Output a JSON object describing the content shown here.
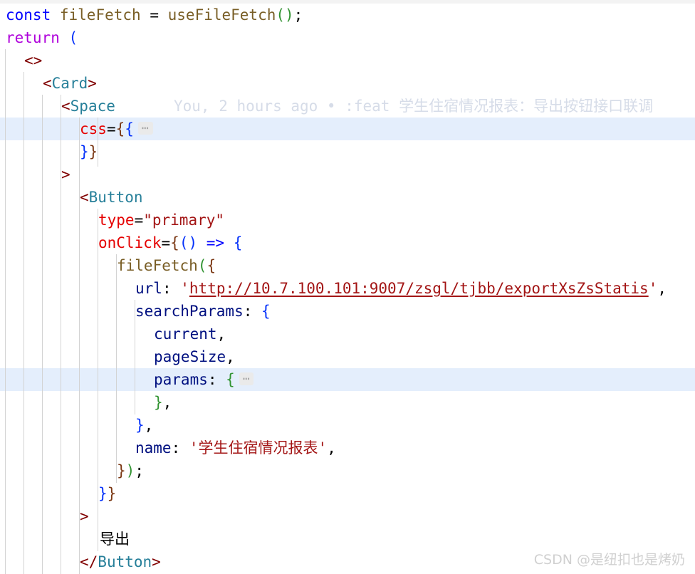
{
  "editor": {
    "language": "tsx",
    "theme": "light",
    "font_size_px": 21,
    "line_height_px": 32,
    "colors": {
      "background": "#ffffff",
      "foreground": "#000000",
      "line_highlight": "#e4eefc",
      "indent_guide": "#d3d3d3",
      "keyword": "#0000ff",
      "control_keyword": "#af00db",
      "function": "#795e26",
      "tag_bracket": "#800000",
      "tag_name": "#267f99",
      "attribute": "#e50000",
      "string": "#a31515",
      "property": "#001080",
      "bracket_level_1": "#0431fa",
      "bracket_level_2": "#319331",
      "bracket_level_3": "#7b3814",
      "fold_placeholder": "#a6a6a6",
      "blame_text": "#d6dce8",
      "watermark": "#d0d0d0"
    },
    "fold_placeholder": "⋯",
    "highlighted_line_numbers": [
      6,
      16
    ]
  },
  "blame": {
    "author": "You",
    "time_ago": "2 hours ago",
    "separator": "•",
    "message": ":feat 学生住宿情况报表：导出按钮接口联调",
    "full_text": "You, 2 hours ago • :feat 学生住宿情况报表：导出按钮接口联调",
    "on_line": 5
  },
  "code": {
    "url_value": "http://10.7.100.101:9007/zsgl/tjbb/exportXsZsStatis",
    "button_type_value": "primary",
    "file_name_value": "学生住宿情况报表",
    "button_label": "导出",
    "hook_name": "useFileFetch",
    "variable_name": "fileFetch",
    "components": [
      "Card",
      "Space",
      "Button"
    ],
    "search_params": [
      "current",
      "pageSize",
      "params"
    ],
    "lines": [
      {
        "n": 1,
        "indent": 0,
        "text": "const fileFetch = useFileFetch();"
      },
      {
        "n": 2,
        "indent": 0,
        "text": "return ("
      },
      {
        "n": 3,
        "indent": 1,
        "text": "<>"
      },
      {
        "n": 4,
        "indent": 2,
        "text": "<Card>"
      },
      {
        "n": 5,
        "indent": 3,
        "text": "<Space"
      },
      {
        "n": 6,
        "indent": 4,
        "text": "css={{ ⋯"
      },
      {
        "n": 7,
        "indent": 4,
        "text": "}}"
      },
      {
        "n": 8,
        "indent": 3,
        "text": ">"
      },
      {
        "n": 9,
        "indent": 4,
        "text": "<Button"
      },
      {
        "n": 10,
        "indent": 5,
        "text": "type=\"primary\""
      },
      {
        "n": 11,
        "indent": 5,
        "text": "onClick={() => {"
      },
      {
        "n": 12,
        "indent": 6,
        "text": "fileFetch({"
      },
      {
        "n": 13,
        "indent": 7,
        "text": "url: 'http://10.7.100.101:9007/zsgl/tjbb/exportXsZsStatis',"
      },
      {
        "n": 14,
        "indent": 7,
        "text": "searchParams: {"
      },
      {
        "n": 15,
        "indent": 8,
        "text": "current,"
      },
      {
        "n": 16,
        "indent": 8,
        "text": "pageSize,"
      },
      {
        "n": 17,
        "indent": 8,
        "text": "params: { ⋯"
      },
      {
        "n": 18,
        "indent": 8,
        "text": "},"
      },
      {
        "n": 19,
        "indent": 7,
        "text": "},"
      },
      {
        "n": 20,
        "indent": 7,
        "text": "name: '学生住宿情况报表',"
      },
      {
        "n": 21,
        "indent": 6,
        "text": "});"
      },
      {
        "n": 22,
        "indent": 5,
        "text": "}}"
      },
      {
        "n": 23,
        "indent": 4,
        "text": ">"
      },
      {
        "n": 24,
        "indent": 5,
        "text": "导出"
      },
      {
        "n": 25,
        "indent": 4,
        "text": "</Button>"
      }
    ]
  },
  "watermark": {
    "text": "CSDN @是纽扣也是烤奶"
  }
}
